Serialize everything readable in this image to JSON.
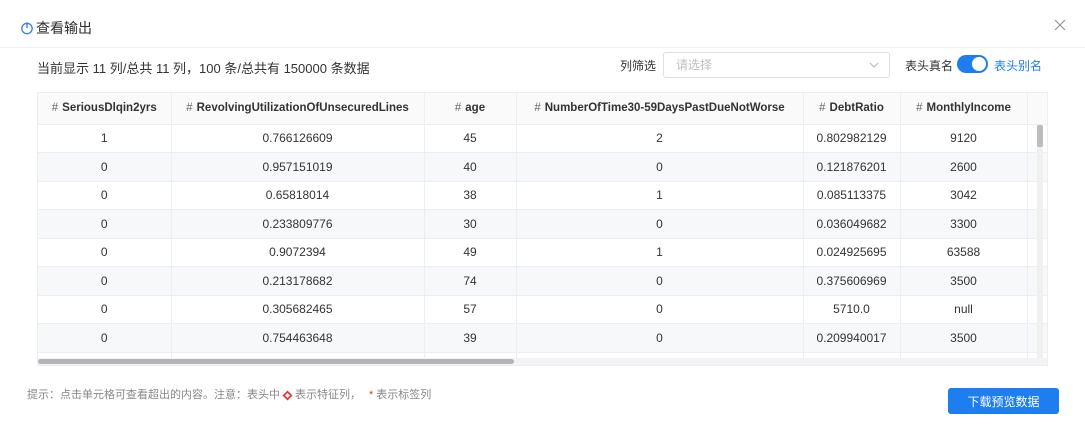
{
  "dialog": {
    "title": "查看输出",
    "icons": {
      "title": "power-icon",
      "close": "close-icon"
    }
  },
  "summary": "当前显示 11 列/总共 11 列，100 条/总共有 150000 条数据",
  "filter": {
    "label": "列筛选",
    "placeholder": "请选择",
    "value": ""
  },
  "header_toggle": {
    "realname_label": "表头真名",
    "alias_label": "表头别名",
    "on": true
  },
  "table": {
    "columns": [
      {
        "hash": "#",
        "name": "SeriousDlqin2yrs"
      },
      {
        "hash": "#",
        "name": "RevolvingUtilizationOfUnsecuredLines"
      },
      {
        "hash": "#",
        "name": "age"
      },
      {
        "hash": "#",
        "name": "NumberOfTime30-59DaysPastDueNotWorse"
      },
      {
        "hash": "#",
        "name": "DebtRatio"
      },
      {
        "hash": "#",
        "name": "MonthlyIncome"
      },
      {
        "hash": "#",
        "name": ""
      }
    ],
    "rows": [
      [
        "1",
        "0.766126609",
        "45",
        "2",
        "0.802982129",
        "9120",
        ""
      ],
      [
        "0",
        "0.957151019",
        "40",
        "0",
        "0.121876201",
        "2600",
        ""
      ],
      [
        "0",
        "0.65818014",
        "38",
        "1",
        "0.085113375",
        "3042",
        ""
      ],
      [
        "0",
        "0.233809776",
        "30",
        "0",
        "0.036049682",
        "3300",
        ""
      ],
      [
        "0",
        "0.9072394",
        "49",
        "1",
        "0.024925695",
        "63588",
        ""
      ],
      [
        "0",
        "0.213178682",
        "74",
        "0",
        "0.375606969",
        "3500",
        ""
      ],
      [
        "0",
        "0.305682465",
        "57",
        "0",
        "5710.0",
        "null",
        ""
      ],
      [
        "0",
        "0.754463648",
        "39",
        "0",
        "0.209940017",
        "3500",
        ""
      ],
      [
        "",
        "",
        "",
        "",
        "",
        "",
        ""
      ]
    ]
  },
  "footer": {
    "tip_prefix": "提示：点击单元格可查看超出的内容。注意：表头中",
    "tip_feature": "表示特征列，",
    "tip_star": "*",
    "tip_label": "表示标签列",
    "download_label": "下载预览数据"
  },
  "colors": {
    "accent": "#1e7ef0",
    "star": "#ee3333"
  }
}
